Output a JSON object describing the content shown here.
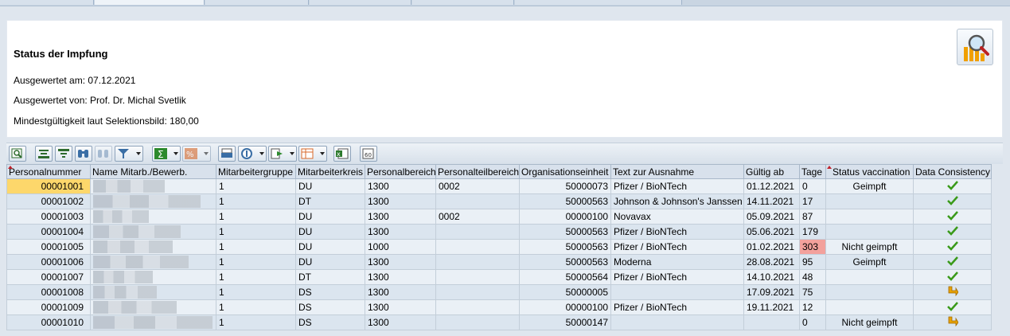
{
  "header": {
    "title": "Status der Impfung",
    "evaluated_on": "Ausgewertet am: 07.12.2021",
    "evaluated_by": "Ausgewertet von: Prof. Dr. Michal Svetlik",
    "min_validity": "Mindestgültigkeit laut Selektionsbild: 180,00"
  },
  "table": {
    "columns": [
      "Personalnummer",
      "Name Mitarb./Bewerb.",
      "Mitarbeitergruppe",
      "Mitarbeiterkreis",
      "Personalbereich",
      "Personalteilbereich",
      "Organisationseinheit",
      "Text zur Ausnahme",
      "Gültig ab",
      "Tage",
      "Status vaccination",
      "Data Consistency"
    ],
    "rows": [
      {
        "pn": "00001001",
        "group": "1",
        "circle": "DU",
        "area": "1300",
        "subarea": "0002",
        "org": "50000073",
        "text": "Pfizer / BioNTech",
        "valid": "01.12.2021",
        "days": "0",
        "status": "Geimpft",
        "consistency": "ok"
      },
      {
        "pn": "00001002",
        "group": "1",
        "circle": "DT",
        "area": "1300",
        "subarea": "",
        "org": "50000563",
        "text": "Johnson & Johnson's Janssen",
        "valid": "14.11.2021",
        "days": "17",
        "status": "",
        "consistency": "ok"
      },
      {
        "pn": "00001003",
        "group": "1",
        "circle": "DU",
        "area": "1300",
        "subarea": "0002",
        "org": "00000100",
        "text": "Novavax",
        "valid": "05.09.2021",
        "days": "87",
        "status": "",
        "consistency": "ok"
      },
      {
        "pn": "00001004",
        "group": "1",
        "circle": "DU",
        "area": "1300",
        "subarea": "",
        "org": "50000563",
        "text": "Pfizer / BioNTech",
        "valid": "05.06.2021",
        "days": "179",
        "status": "",
        "consistency": "ok"
      },
      {
        "pn": "00001005",
        "group": "1",
        "circle": "DU",
        "area": "1000",
        "subarea": "",
        "org": "50000563",
        "text": "Pfizer / BioNTech",
        "valid": "01.02.2021",
        "days": "303",
        "status": "Nicht geimpft",
        "consistency": "ok"
      },
      {
        "pn": "00001006",
        "group": "1",
        "circle": "DU",
        "area": "1300",
        "subarea": "",
        "org": "50000563",
        "text": "Moderna",
        "valid": "28.08.2021",
        "days": "95",
        "status": "Geimpft",
        "consistency": "ok"
      },
      {
        "pn": "00001007",
        "group": "1",
        "circle": "DT",
        "area": "1300",
        "subarea": "",
        "org": "50000564",
        "text": "Pfizer / BioNTech",
        "valid": "14.10.2021",
        "days": "48",
        "status": "",
        "consistency": "ok"
      },
      {
        "pn": "00001008",
        "group": "1",
        "circle": "DS",
        "area": "1300",
        "subarea": "",
        "org": "50000005",
        "text": "",
        "valid": "17.09.2021",
        "days": "75",
        "status": "",
        "consistency": "warning"
      },
      {
        "pn": "00001009",
        "group": "1",
        "circle": "DS",
        "area": "1300",
        "subarea": "",
        "org": "00000100",
        "text": "Pfizer / BioNTech",
        "valid": "19.11.2021",
        "days": "12",
        "status": "",
        "consistency": "ok"
      },
      {
        "pn": "00001010",
        "group": "1",
        "circle": "DS",
        "area": "1300",
        "subarea": "",
        "org": "50000147",
        "text": "",
        "valid": "",
        "days": "0",
        "status": "Nicht geimpft",
        "consistency": "warning"
      }
    ]
  },
  "colors": {
    "selected_cell": "#fdd76b",
    "highlight_days": "#f3a19c",
    "check": "#3a9a1a",
    "warning": "#e8a200"
  },
  "toolbar_icons": [
    "details-icon",
    "sort-ascending-icon",
    "sort-descending-icon",
    "find-icon",
    "find-next-icon",
    "filter-icon",
    "sum-icon",
    "subtotal-icon",
    "print-preview-icon",
    "views-icon",
    "export-icon",
    "layout-icon",
    "excel-icon",
    "abc-analysis-icon"
  ]
}
